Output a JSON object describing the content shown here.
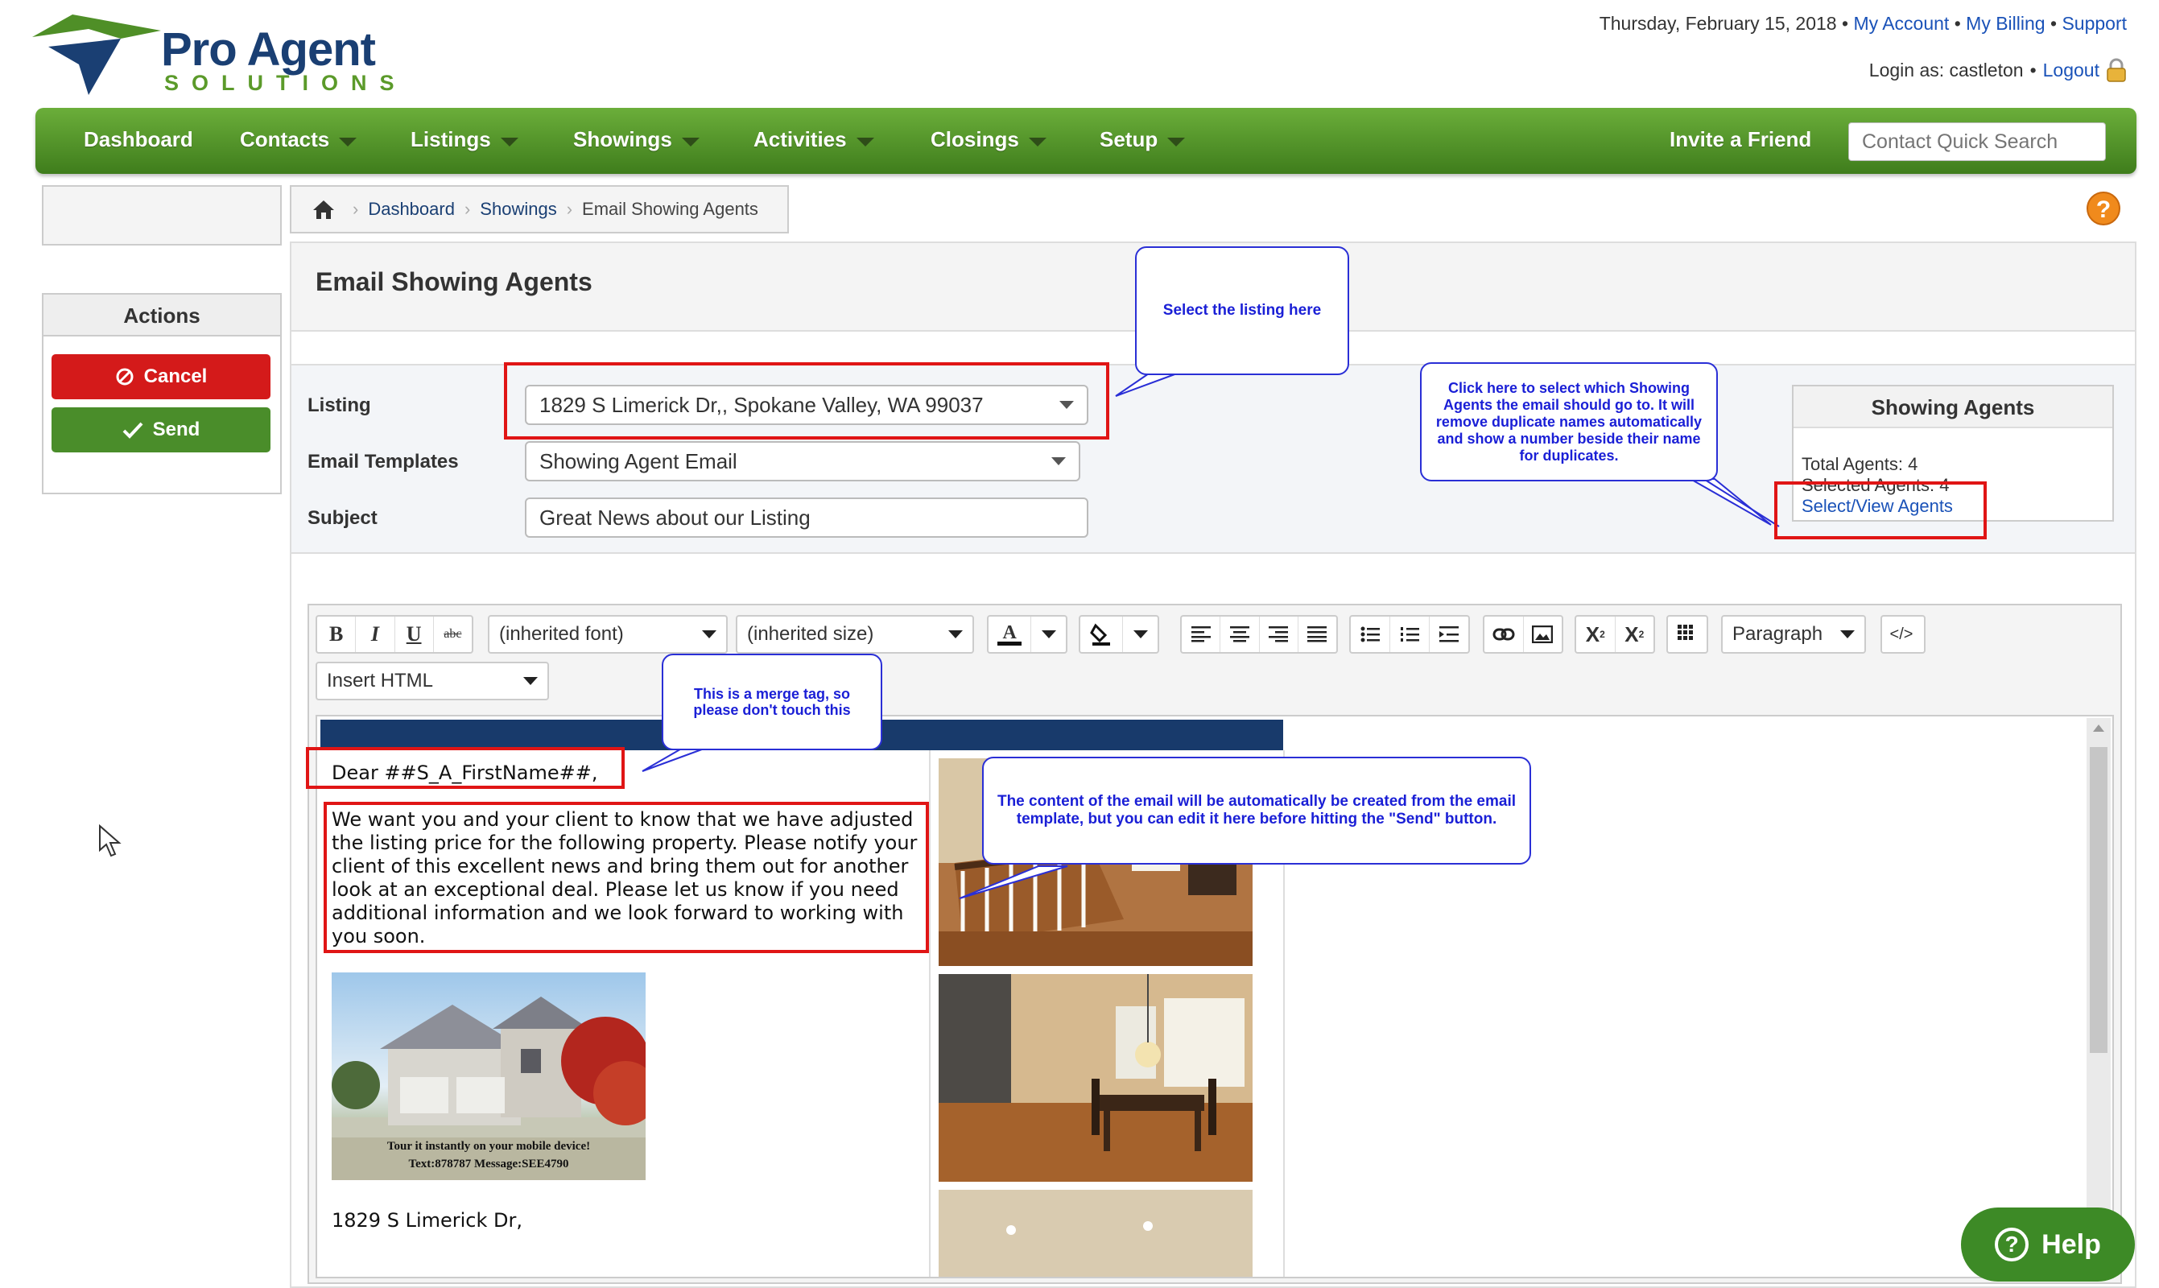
{
  "brand": {
    "name_top": "Pro Agent",
    "name_bottom": "SOLUTIONS"
  },
  "header": {
    "date": "Thursday, February 15, 2018",
    "my_account": "My Account",
    "my_billing": "My Billing",
    "support": "Support",
    "login_as": "Login as: castleton",
    "logout": "Logout",
    "bullet": "•"
  },
  "nav": {
    "items": [
      "Dashboard",
      "Contacts",
      "Listings",
      "Showings",
      "Activities",
      "Closings",
      "Setup"
    ],
    "invite": "Invite a Friend",
    "quick_search_placeholder": "Contact Quick Search"
  },
  "actions": {
    "title": "Actions",
    "cancel": "Cancel",
    "send": "Send"
  },
  "breadcrumb": [
    "Dashboard",
    "Showings",
    "Email Showing Agents"
  ],
  "page": {
    "title": "Email Showing Agents"
  },
  "form": {
    "listing_label": "Listing",
    "listing_value": "1829 S Limerick Dr,, Spokane Valley, WA 99037",
    "templates_label": "Email Templates",
    "templates_value": "Showing Agent Email",
    "subject_label": "Subject",
    "subject_value": "Great News about our Listing"
  },
  "showing_agents": {
    "title": "Showing Agents",
    "total": "Total Agents: 4",
    "selected": "Selected Agents: 4",
    "link": "Select/View Agents"
  },
  "editor": {
    "bold": "B",
    "italic": "I",
    "underline": "U",
    "strike": "abc",
    "font": "(inherited font)",
    "size": "(inherited size)",
    "paragraph": "Paragraph",
    "insert_html": "Insert HTML",
    "source": "</>"
  },
  "email": {
    "greeting": "Dear ##S_A_FirstName##,",
    "body": "We want you and your client to know that we have adjusted the listing price for the following property. Please notify your client of this excellent news and bring them out for another look at an exceptional deal. Please let us know if you need additional information and we look forward to working with you soon.",
    "tour_line1": "Tour it instantly on your mobile device!",
    "tour_line2": "Text:878787 Message:SEE4790",
    "address": "1829 S Limerick Dr,"
  },
  "callouts": {
    "listing": "Select the listing here",
    "agents": "Click here to select which Showing Agents the email should go to. It will remove duplicate names automatically and show a number beside their name for duplicates.",
    "merge": "This is a merge tag, so please don't touch this",
    "content": "The content of the email will be automatically be created from the email template, but you can edit it here before hitting the \"Send\" button."
  },
  "help": {
    "label": "Help"
  },
  "colors": {
    "nav_green": "#4f8f27",
    "brand_blue": "#1a3f73",
    "callout_blue": "#2a2fd6",
    "highlight_red": "#e01515"
  }
}
